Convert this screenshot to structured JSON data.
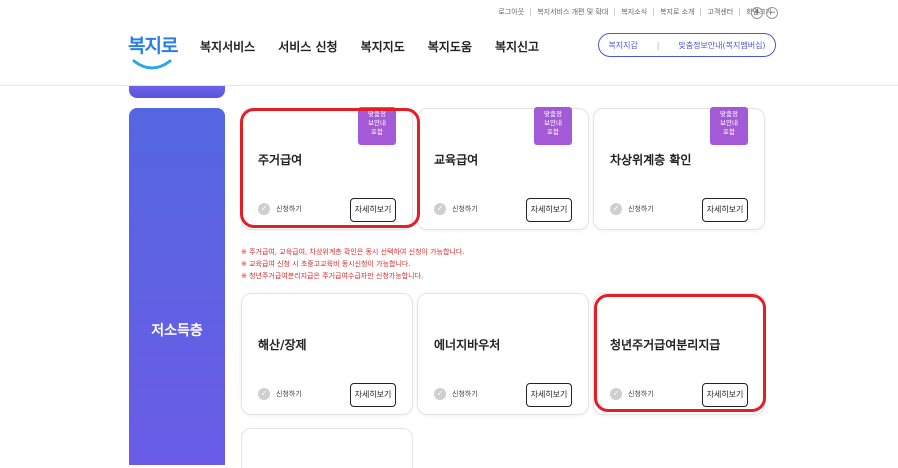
{
  "utility_links": [
    "로그아웃",
    "복지서비스 개편 및 확대",
    "복지소식",
    "복지로 소개",
    "고객센터",
    "화면크기"
  ],
  "zoom": {
    "in": "+",
    "out": "−"
  },
  "logo": {
    "text": "복지로"
  },
  "gnb": [
    "복지서비스",
    "서비스 신청",
    "복지지도",
    "복지도움",
    "복지신고"
  ],
  "header_pill": {
    "left": "복지지갑",
    "separator": "|",
    "right": "맞춤정보안내(복지멤버십)"
  },
  "category": {
    "label": "저소득층"
  },
  "cards": [
    {
      "title": "주거급여",
      "apply": "신청하기",
      "detail": "자세히보기",
      "badge": [
        "맞춤정",
        "보안내",
        "포함"
      ]
    },
    {
      "title": "교육급여",
      "apply": "신청하기",
      "detail": "자세히보기",
      "badge": [
        "맞춤정",
        "보안내",
        "포함"
      ]
    },
    {
      "title": "차상위계층 확인",
      "apply": "신청하기",
      "detail": "자세히보기",
      "badge": [
        "맞춤정",
        "보안내",
        "포함"
      ]
    },
    {
      "title": "해산/장제",
      "apply": "신청하기",
      "detail": "자세히보기"
    },
    {
      "title": "에너지바우처",
      "apply": "신청하기",
      "detail": "자세히보기"
    },
    {
      "title": "청년주거급여분리지급",
      "apply": "신청하기",
      "detail": "자세히보기"
    }
  ],
  "notes": [
    "※ 주거급여, 교육급여, 차상위계층 확인은 동시 선택하여 신청이 가능합니다.",
    "※ 교육급여 신청 시 초중고교육비 동시신청이 가능합니다.",
    "※ 청년주거급여분리지급은 주거급여수급자만 신청가능합니다."
  ],
  "colors": {
    "accent": "#4a57d6",
    "category_bg": "#5b5fe3",
    "badge": "#a35ad6",
    "highlight": "#e41e26",
    "note": "#e1292b"
  }
}
